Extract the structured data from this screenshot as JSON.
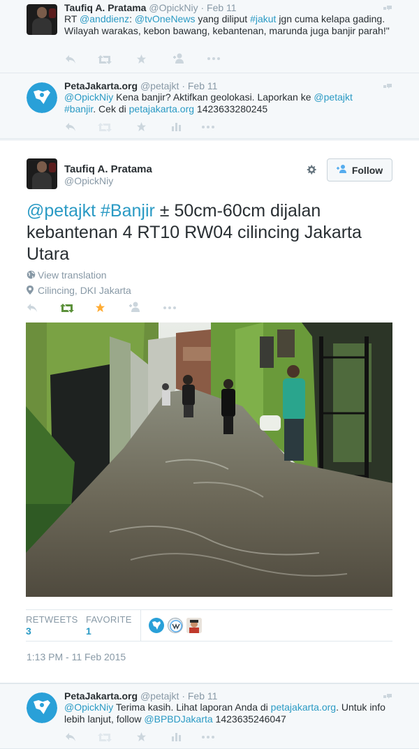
{
  "tweet1": {
    "name": "Taufiq A. Pratama",
    "handle": "@OpickNiy",
    "sep": "·",
    "date": "Feb 11",
    "rt": "RT",
    "mention1": "@anddienz",
    "colon": ":",
    "mention2": "@tvOneNews",
    "mid": "yang diliput",
    "hashtag": "#jakut",
    "rest": "jgn cuma kelapa gading. Wilayah warakas, kebon bawang, kebantenan, marunda juga banjir parah!\""
  },
  "tweet2": {
    "name": "PetaJakarta.org",
    "handle": "@petajkt",
    "sep": "·",
    "date": "Feb 11",
    "mention": "@OpickNiy",
    "t1": "Kena banjir? Aktifkan geolokasi. Laporkan ke",
    "mention2": "@petajkt",
    "hashtag": "#banjir",
    "t2": ". Cek di",
    "link": "petajakarta.org",
    "t3": "1423633280245"
  },
  "main": {
    "name": "Taufiq A. Pratama",
    "handle": "@OpickNiy",
    "follow": "Follow",
    "mention": "@petajkt",
    "hashtag": "#Banjir",
    "text": "± 50cm-60cm dijalan kebantenan 4 RT10 RW04 cilincing Jakarta Utara",
    "view_translation": "View translation",
    "location": "Cilincing, DKI Jakarta",
    "retweets_label": "RETWEETS",
    "retweets": "3",
    "favorite_label": "FAVORITE",
    "favorite": "1",
    "timestamp": "1:13 PM - 11 Feb 2015"
  },
  "tweet3": {
    "name": "PetaJakarta.org",
    "handle": "@petajkt",
    "sep": "·",
    "date": "Feb 11",
    "mention": "@OpickNiy",
    "t1": "Terima kasih. Lihat laporan Anda di",
    "link": "petajakarta.org",
    "t2": ". Untuk info lebih lanjut, follow",
    "mention2": "@BPBDJakarta",
    "t3": "1423635246047"
  },
  "colors": {
    "link": "#2a9ac4",
    "retweet_active": "#5c913b",
    "favorite_active": "#ffac33",
    "muted": "#8899a6"
  }
}
